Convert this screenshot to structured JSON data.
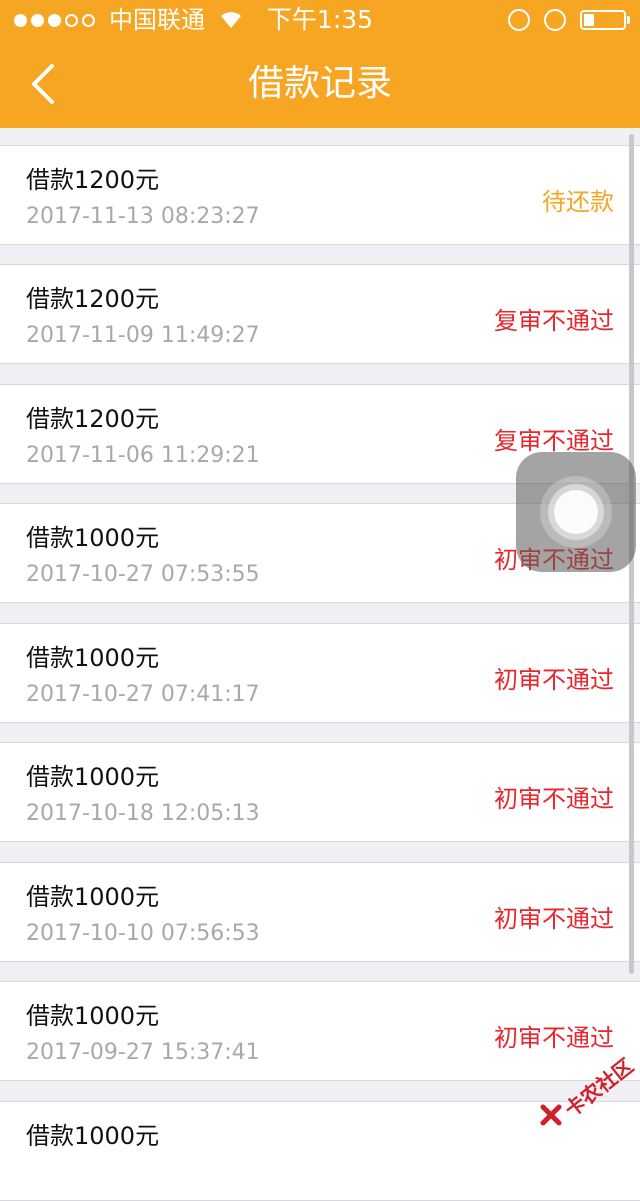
{
  "status_bar": {
    "carrier": "中国联通",
    "time": "下午1:35"
  },
  "header": {
    "title": "借款记录",
    "back_icon": "chevron-left-icon"
  },
  "colors": {
    "header_bg": "#f6a623",
    "pending": "#f5a623",
    "rejected": "#e8262c"
  },
  "records": [
    {
      "amount": "借款1200元",
      "time": "2017-11-13 08:23:27",
      "status": "待还款",
      "status_color": "#f5a623"
    },
    {
      "amount": "借款1200元",
      "time": "2017-11-09 11:49:27",
      "status": "复审不通过",
      "status_color": "#e8262c"
    },
    {
      "amount": "借款1200元",
      "time": "2017-11-06 11:29:21",
      "status": "复审不通过",
      "status_color": "#e8262c"
    },
    {
      "amount": "借款1000元",
      "time": "2017-10-27 07:53:55",
      "status": "初审不通过",
      "status_color": "#e8262c"
    },
    {
      "amount": "借款1000元",
      "time": "2017-10-27 07:41:17",
      "status": "初审不通过",
      "status_color": "#e8262c"
    },
    {
      "amount": "借款1000元",
      "time": "2017-10-18 12:05:13",
      "status": "初审不通过",
      "status_color": "#e8262c"
    },
    {
      "amount": "借款1000元",
      "time": "2017-10-10 07:56:53",
      "status": "初审不通过",
      "status_color": "#e8262c"
    },
    {
      "amount": "借款1000元",
      "time": "2017-09-27 15:37:41",
      "status": "初审不通过",
      "status_color": "#e8262c"
    },
    {
      "amount": "借款1000元",
      "time": "",
      "status": "",
      "status_color": "#e8262c"
    }
  ],
  "watermark": {
    "text": "卡农社区"
  }
}
